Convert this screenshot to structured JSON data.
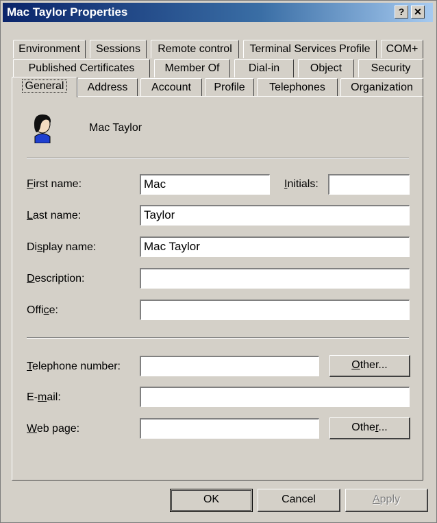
{
  "window": {
    "title": "Mac Taylor Properties",
    "help_label": "?",
    "close_label": "✕"
  },
  "tabs": {
    "row1": [
      "Environment",
      "Sessions",
      "Remote control",
      "Terminal Services Profile",
      "COM+"
    ],
    "row2": [
      "Published Certificates",
      "Member Of",
      "Dial-in",
      "Object",
      "Security"
    ],
    "row3": [
      "General",
      "Address",
      "Account",
      "Profile",
      "Telephones",
      "Organization"
    ],
    "active": "General"
  },
  "general": {
    "user_icon": "user-icon",
    "display_user": "Mac Taylor",
    "first_name": {
      "label_key": "F",
      "label_rest": "irst name:",
      "value": "Mac"
    },
    "initials": {
      "label_key": "I",
      "label_rest": "nitials:",
      "value": ""
    },
    "last_name": {
      "label_key": "L",
      "label_rest": "ast name:",
      "value": "Taylor"
    },
    "display_name": {
      "label_pre": "Di",
      "label_key": "s",
      "label_rest": "play name:",
      "value": "Mac Taylor"
    },
    "description": {
      "label_key": "D",
      "label_rest": "escription:",
      "value": ""
    },
    "office": {
      "label_pre": "Offi",
      "label_key": "c",
      "label_rest": "e:",
      "value": ""
    },
    "telephone": {
      "label_key": "T",
      "label_rest": "elephone number:",
      "value": ""
    },
    "email": {
      "label_pre": "E-",
      "label_key": "m",
      "label_rest": "ail:",
      "value": ""
    },
    "webpage": {
      "label_key": "W",
      "label_rest": "eb page:",
      "value": ""
    },
    "other_tel": {
      "key": "O",
      "rest": "ther..."
    },
    "other_web": {
      "pre": "Othe",
      "key": "r",
      "rest": "..."
    }
  },
  "footer": {
    "ok": "OK",
    "cancel": "Cancel",
    "apply_key": "A",
    "apply_rest": "pply"
  }
}
